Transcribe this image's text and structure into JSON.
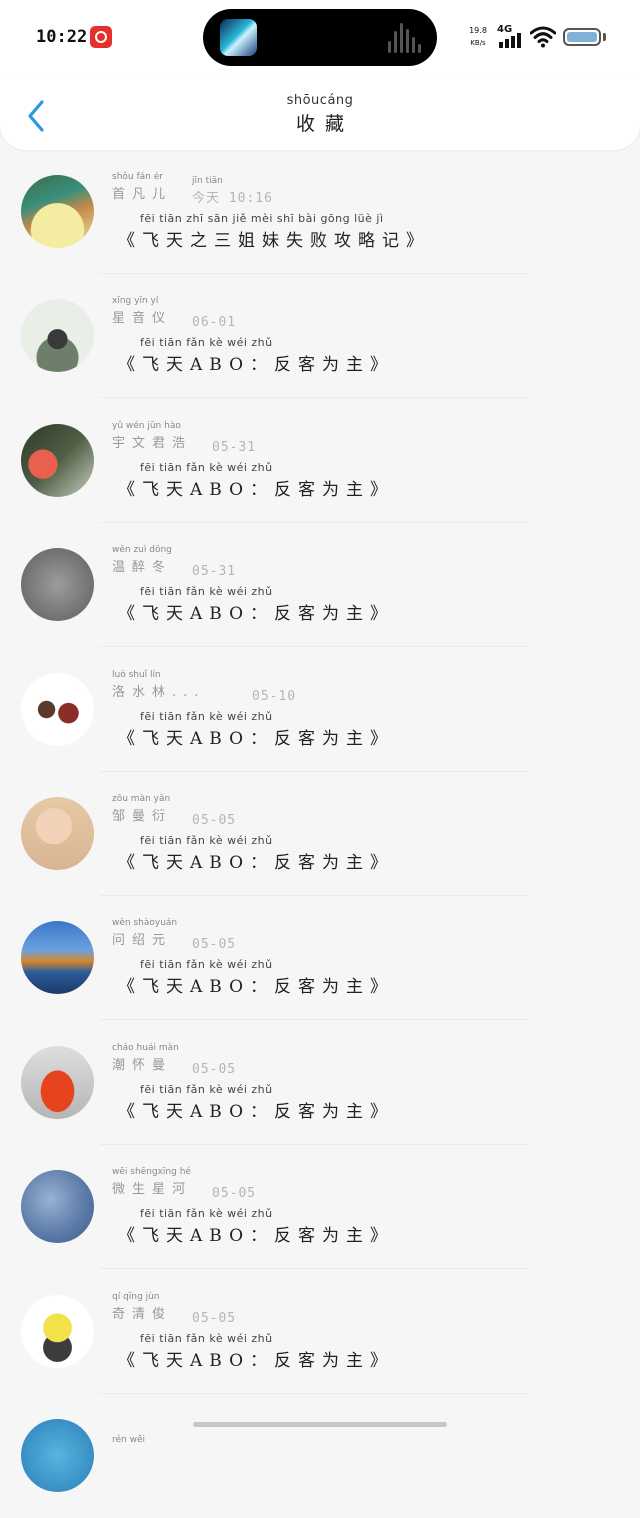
{
  "status_bar": {
    "time": "10:22",
    "net_speed_value": "19.8",
    "net_speed_unit": "KB/s",
    "network_type": "4G",
    "battery_percent": 95
  },
  "header": {
    "title_pinyin": "shōucáng",
    "title": "收藏",
    "back_icon": "chevron-left-icon",
    "accent_color": "#2b98e4"
  },
  "items": [
    {
      "name_pinyin": "shǒu fán  ér",
      "name": "首凡儿",
      "time_pinyin": "jīn tiān",
      "time": "今天 10:16",
      "title_pinyin": "fēi tiān zhī sān jiě mèi shī bài gōng lüè  jì",
      "title": "《飞天之三姐妹失败攻略记》"
    },
    {
      "name_pinyin": "xīng yīn  yí",
      "name": "星音仪",
      "time_pinyin": "",
      "time": "06-01",
      "title_pinyin": "fēi tiān              fǎn  kè  wéi zhǔ",
      "title": "《飞天ABO：反客为主》"
    },
    {
      "name_pinyin": "yǔ wén jūn hào",
      "name": "宇文君浩",
      "time_pinyin": "",
      "time": "05-31",
      "title_pinyin": "fēi tiān              fǎn  kè  wéi zhǔ",
      "title": "《飞天ABO：反客为主》"
    },
    {
      "name_pinyin": "wēn zuì dōng",
      "name": "温醉冬",
      "time_pinyin": "",
      "time": "05-31",
      "title_pinyin": "fēi tiān              fǎn  kè  wéi zhǔ",
      "title": "《飞天ABO：反客为主》"
    },
    {
      "name_pinyin": "luò shuǐ lín",
      "name": "洛水林...",
      "time_pinyin": "",
      "time": "05-10",
      "title_pinyin": "fēi tiān              fǎn  kè  wéi zhǔ",
      "title": "《飞天ABO：反客为主》"
    },
    {
      "name_pinyin": "zōu màn yǎn",
      "name": "邹曼衍",
      "time_pinyin": "",
      "time": "05-05",
      "title_pinyin": "fēi tiān              fǎn  kè  wéi zhǔ",
      "title": "《飞天ABO：反客为主》"
    },
    {
      "name_pinyin": "wèn shàoyuán",
      "name": "问绍元",
      "time_pinyin": "",
      "time": "05-05",
      "title_pinyin": "fēi tiān              fǎn  kè  wéi zhǔ",
      "title": "《飞天ABO：反客为主》"
    },
    {
      "name_pinyin": "cháo huái màn",
      "name": "潮怀曼",
      "time_pinyin": "",
      "time": "05-05",
      "title_pinyin": "fēi tiān              fǎn  kè  wéi zhǔ",
      "title": "《飞天ABO：反客为主》"
    },
    {
      "name_pinyin": "wēi shēngxīng hé",
      "name": "微生星河",
      "time_pinyin": "",
      "time": "05-05",
      "title_pinyin": "fēi tiān              fǎn  kè  wéi zhǔ",
      "title": "《飞天ABO：反客为主》"
    },
    {
      "name_pinyin": "qí qīng jùn",
      "name": "奇清俊",
      "time_pinyin": "",
      "time": "05-05",
      "title_pinyin": "fēi tiān              fǎn  kè  wéi zhǔ",
      "title": "《飞天ABO：反客为主》"
    },
    {
      "name_pinyin": "rén wěi",
      "name": "",
      "time_pinyin": "",
      "time": "",
      "title_pinyin": "",
      "title": ""
    }
  ]
}
